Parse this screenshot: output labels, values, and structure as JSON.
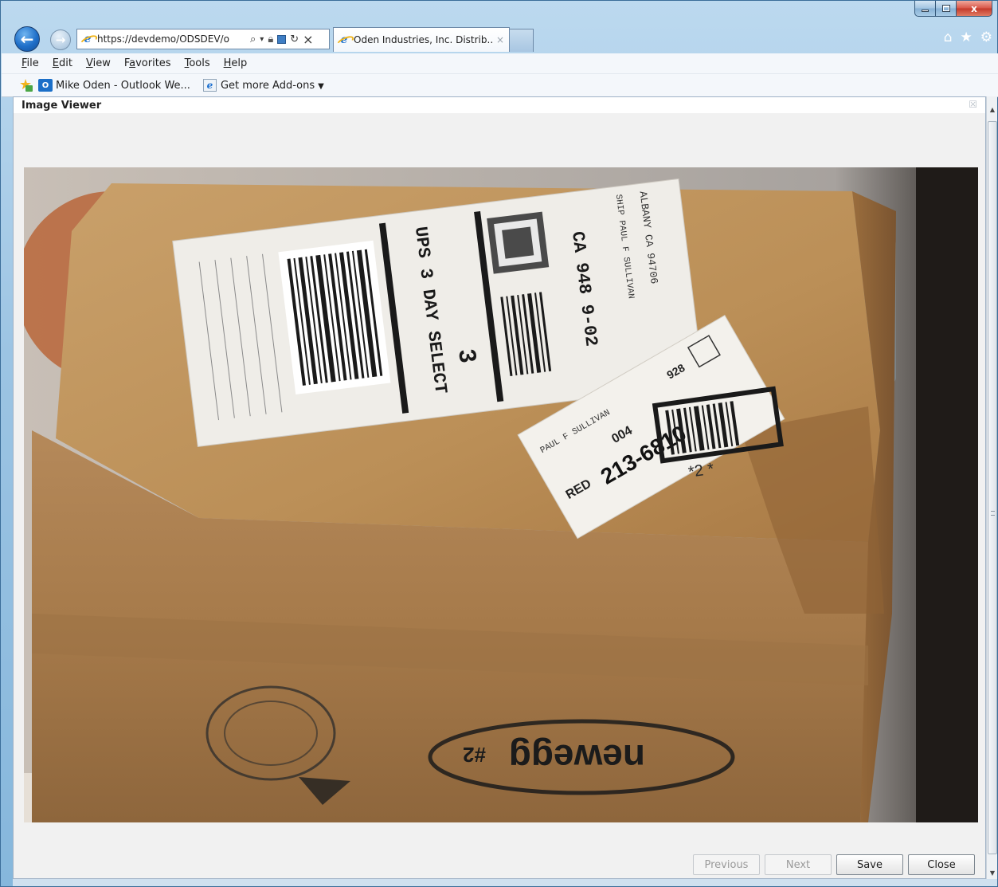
{
  "window": {
    "title_tab": "Oden Industries, Inc. Distrib...",
    "tab_close": "×",
    "controls": {
      "minimize": "–",
      "maximize": "□",
      "close": "x"
    }
  },
  "navigation": {
    "back_icon": "arrow-left",
    "forward_icon": "arrow-right",
    "url": "https://devdemo/ODSDEV/o",
    "search_glyph": "⌕",
    "dropdown_glyph": "▾",
    "refresh_glyph": "↻",
    "stop_glyph": "×",
    "right_icons": [
      "⌂",
      "★",
      "⚙"
    ]
  },
  "menu": [
    {
      "key": "F",
      "rest": "ile"
    },
    {
      "key": "E",
      "rest": "dit"
    },
    {
      "key": "V",
      "rest": "iew"
    },
    {
      "pre": "F",
      "key": "a",
      "rest": "vorites"
    },
    {
      "key": "T",
      "rest": "ools"
    },
    {
      "key": "H",
      "rest": "elp"
    }
  ],
  "favorites": {
    "outlook_badge": "O",
    "item1": "Mike Oden - Outlook We...",
    "item2": "Get more Add-ons",
    "item2_arrow": "▼"
  },
  "panel": {
    "title": "Image Viewer",
    "close_glyph": "☒"
  },
  "photo": {
    "label_service": "UPS 3 DAY SELECT",
    "label_number": "3",
    "label_route": "CA 948 9-02",
    "ship_to": "SHIP PAUL F SULLIVAN",
    "ship_city": "ALBANY CA 94706",
    "sticker_name": "PAUL F SULLIVAN",
    "sticker_code": "928",
    "sticker_num": "213-6810",
    "sticker_red": "RED",
    "sticker_004": "004",
    "box_mark": "*2 *",
    "brand": "newegg",
    "brand_suffix": "#2"
  },
  "buttons": {
    "previous": "Previous",
    "next": "Next",
    "save": "Save",
    "close": "Close"
  },
  "colors": {
    "accent": "#1f6fc9",
    "cardboard": "#b58a56"
  }
}
